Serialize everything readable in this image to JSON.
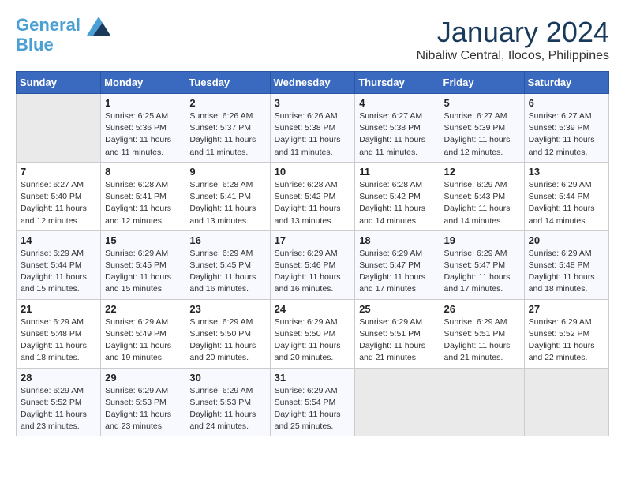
{
  "logo": {
    "line1": "General",
    "line2": "Blue"
  },
  "title": "January 2024",
  "location": "Nibaliw Central, Ilocos, Philippines",
  "days_of_week": [
    "Sunday",
    "Monday",
    "Tuesday",
    "Wednesday",
    "Thursday",
    "Friday",
    "Saturday"
  ],
  "weeks": [
    [
      {
        "day": "",
        "info": ""
      },
      {
        "day": "1",
        "info": "Sunrise: 6:25 AM\nSunset: 5:36 PM\nDaylight: 11 hours\nand 11 minutes."
      },
      {
        "day": "2",
        "info": "Sunrise: 6:26 AM\nSunset: 5:37 PM\nDaylight: 11 hours\nand 11 minutes."
      },
      {
        "day": "3",
        "info": "Sunrise: 6:26 AM\nSunset: 5:38 PM\nDaylight: 11 hours\nand 11 minutes."
      },
      {
        "day": "4",
        "info": "Sunrise: 6:27 AM\nSunset: 5:38 PM\nDaylight: 11 hours\nand 11 minutes."
      },
      {
        "day": "5",
        "info": "Sunrise: 6:27 AM\nSunset: 5:39 PM\nDaylight: 11 hours\nand 12 minutes."
      },
      {
        "day": "6",
        "info": "Sunrise: 6:27 AM\nSunset: 5:39 PM\nDaylight: 11 hours\nand 12 minutes."
      }
    ],
    [
      {
        "day": "7",
        "info": "Sunrise: 6:27 AM\nSunset: 5:40 PM\nDaylight: 11 hours\nand 12 minutes."
      },
      {
        "day": "8",
        "info": "Sunrise: 6:28 AM\nSunset: 5:41 PM\nDaylight: 11 hours\nand 12 minutes."
      },
      {
        "day": "9",
        "info": "Sunrise: 6:28 AM\nSunset: 5:41 PM\nDaylight: 11 hours\nand 13 minutes."
      },
      {
        "day": "10",
        "info": "Sunrise: 6:28 AM\nSunset: 5:42 PM\nDaylight: 11 hours\nand 13 minutes."
      },
      {
        "day": "11",
        "info": "Sunrise: 6:28 AM\nSunset: 5:42 PM\nDaylight: 11 hours\nand 14 minutes."
      },
      {
        "day": "12",
        "info": "Sunrise: 6:29 AM\nSunset: 5:43 PM\nDaylight: 11 hours\nand 14 minutes."
      },
      {
        "day": "13",
        "info": "Sunrise: 6:29 AM\nSunset: 5:44 PM\nDaylight: 11 hours\nand 14 minutes."
      }
    ],
    [
      {
        "day": "14",
        "info": "Sunrise: 6:29 AM\nSunset: 5:44 PM\nDaylight: 11 hours\nand 15 minutes."
      },
      {
        "day": "15",
        "info": "Sunrise: 6:29 AM\nSunset: 5:45 PM\nDaylight: 11 hours\nand 15 minutes."
      },
      {
        "day": "16",
        "info": "Sunrise: 6:29 AM\nSunset: 5:45 PM\nDaylight: 11 hours\nand 16 minutes."
      },
      {
        "day": "17",
        "info": "Sunrise: 6:29 AM\nSunset: 5:46 PM\nDaylight: 11 hours\nand 16 minutes."
      },
      {
        "day": "18",
        "info": "Sunrise: 6:29 AM\nSunset: 5:47 PM\nDaylight: 11 hours\nand 17 minutes."
      },
      {
        "day": "19",
        "info": "Sunrise: 6:29 AM\nSunset: 5:47 PM\nDaylight: 11 hours\nand 17 minutes."
      },
      {
        "day": "20",
        "info": "Sunrise: 6:29 AM\nSunset: 5:48 PM\nDaylight: 11 hours\nand 18 minutes."
      }
    ],
    [
      {
        "day": "21",
        "info": "Sunrise: 6:29 AM\nSunset: 5:48 PM\nDaylight: 11 hours\nand 18 minutes."
      },
      {
        "day": "22",
        "info": "Sunrise: 6:29 AM\nSunset: 5:49 PM\nDaylight: 11 hours\nand 19 minutes."
      },
      {
        "day": "23",
        "info": "Sunrise: 6:29 AM\nSunset: 5:50 PM\nDaylight: 11 hours\nand 20 minutes."
      },
      {
        "day": "24",
        "info": "Sunrise: 6:29 AM\nSunset: 5:50 PM\nDaylight: 11 hours\nand 20 minutes."
      },
      {
        "day": "25",
        "info": "Sunrise: 6:29 AM\nSunset: 5:51 PM\nDaylight: 11 hours\nand 21 minutes."
      },
      {
        "day": "26",
        "info": "Sunrise: 6:29 AM\nSunset: 5:51 PM\nDaylight: 11 hours\nand 21 minutes."
      },
      {
        "day": "27",
        "info": "Sunrise: 6:29 AM\nSunset: 5:52 PM\nDaylight: 11 hours\nand 22 minutes."
      }
    ],
    [
      {
        "day": "28",
        "info": "Sunrise: 6:29 AM\nSunset: 5:52 PM\nDaylight: 11 hours\nand 23 minutes."
      },
      {
        "day": "29",
        "info": "Sunrise: 6:29 AM\nSunset: 5:53 PM\nDaylight: 11 hours\nand 23 minutes."
      },
      {
        "day": "30",
        "info": "Sunrise: 6:29 AM\nSunset: 5:53 PM\nDaylight: 11 hours\nand 24 minutes."
      },
      {
        "day": "31",
        "info": "Sunrise: 6:29 AM\nSunset: 5:54 PM\nDaylight: 11 hours\nand 25 minutes."
      },
      {
        "day": "",
        "info": ""
      },
      {
        "day": "",
        "info": ""
      },
      {
        "day": "",
        "info": ""
      }
    ]
  ]
}
